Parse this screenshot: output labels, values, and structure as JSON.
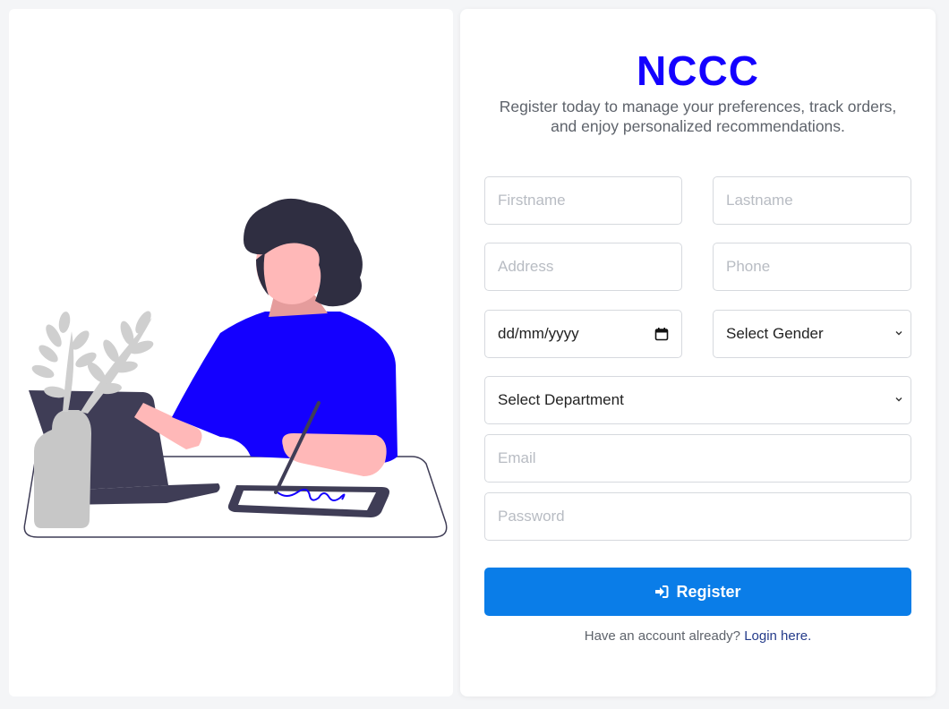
{
  "brand": {
    "title": "NCCC",
    "color": "#1400ff"
  },
  "subtitle": "Register today to manage your preferences, track orders, and enjoy personalized recommendations.",
  "form": {
    "firstname": {
      "placeholder": "Firstname",
      "value": ""
    },
    "lastname": {
      "placeholder": "Lastname",
      "value": ""
    },
    "address": {
      "placeholder": "Address",
      "value": ""
    },
    "phone": {
      "placeholder": "Phone",
      "value": ""
    },
    "dob": {
      "display": "dd/mm/yyyy",
      "icon": "calendar-icon"
    },
    "gender": {
      "selected": "Select Gender",
      "icon": "chevron-down-icon"
    },
    "department": {
      "selected": "Select Department",
      "icon": "chevron-down-icon"
    },
    "email": {
      "placeholder": "Email",
      "value": ""
    },
    "password": {
      "placeholder": "Password",
      "value": ""
    }
  },
  "register_button": {
    "label": "Register",
    "icon": "sign-in-icon",
    "color": "#0a7de8"
  },
  "login_prompt": {
    "text": "Have an account already?",
    "link": "Login here."
  },
  "illustration": {
    "name": "woman-at-desk-illustration",
    "accent": "#1400ff"
  }
}
